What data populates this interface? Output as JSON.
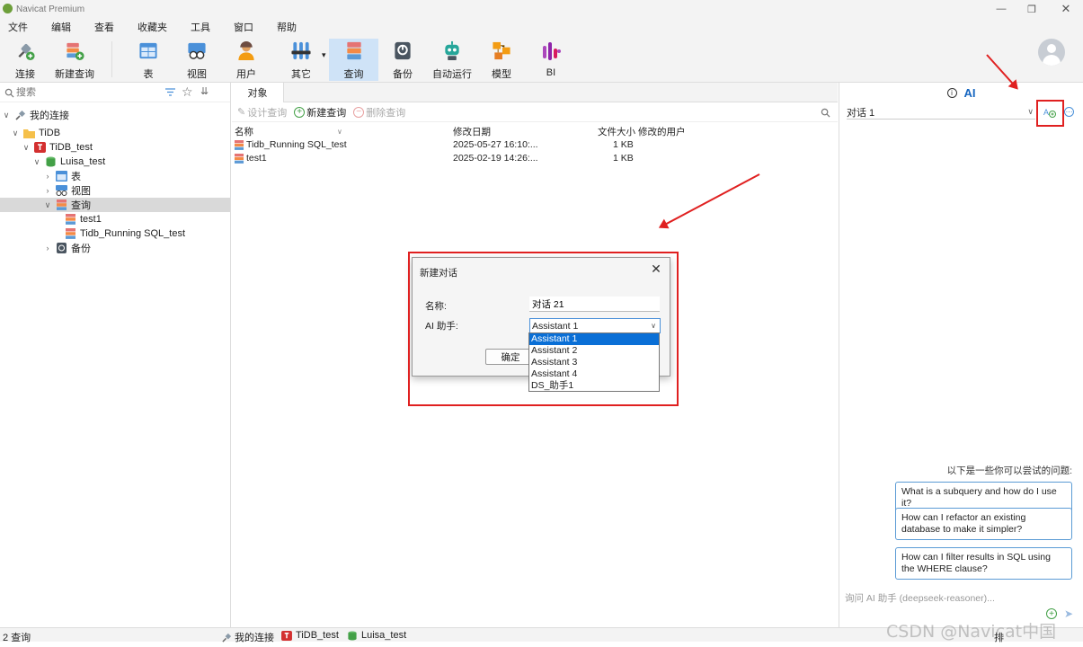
{
  "window": {
    "title": "Navicat Premium"
  },
  "menu": [
    "文件",
    "编辑",
    "查看",
    "收藏夹",
    "工具",
    "窗口",
    "帮助"
  ],
  "toolbar": {
    "tools": [
      {
        "label": "连接",
        "icon": "connection-icon"
      },
      {
        "label": "新建查询",
        "icon": "new-query-icon"
      },
      {
        "label": "表",
        "icon": "table-icon"
      },
      {
        "label": "视图",
        "icon": "view-icon"
      },
      {
        "label": "用户",
        "icon": "user-icon"
      },
      {
        "label": "其它",
        "icon": "other-icon"
      },
      {
        "label": "查询",
        "icon": "query-icon"
      },
      {
        "label": "备份",
        "icon": "backup-icon"
      },
      {
        "label": "自动运行",
        "icon": "automation-icon"
      },
      {
        "label": "模型",
        "icon": "model-icon"
      },
      {
        "label": "BI",
        "icon": "bi-icon"
      }
    ],
    "active_tool": "查询"
  },
  "sidebar": {
    "search_placeholder": "搜索",
    "tree": {
      "root": "我的连接",
      "group": "TiDB",
      "connection": "TiDB_test",
      "database": "Luisa_test",
      "table_node": "表",
      "view_node": "视图",
      "query_node": "查询",
      "query_items": [
        "test1",
        "Tidb_Running SQL_test"
      ],
      "backup_node": "备份"
    }
  },
  "center": {
    "tab": "对象",
    "toolbar": {
      "design": "设计查询",
      "new": "新建查询",
      "delete": "删除查询"
    },
    "columns": [
      "名称",
      "修改日期",
      "文件大小",
      "修改的用户"
    ],
    "rows": [
      {
        "name": "Tidb_Running SQL_test",
        "date": "2025-05-27 16:10:...",
        "size": "1 KB"
      },
      {
        "name": "test1",
        "date": "2025-02-19 14:26:...",
        "size": "1 KB"
      }
    ]
  },
  "dialog": {
    "title": "新建对话",
    "name_label": "名称:",
    "name_value": "对话 21",
    "assistant_label": "AI 助手:",
    "assistant_value": "Assistant 1",
    "ok": "确定",
    "options": [
      "Assistant 1",
      "Assistant 2",
      "Assistant 3",
      "Assistant 4",
      "DS_助手1"
    ]
  },
  "ai_panel": {
    "header": "AI",
    "conversation": "对话 1",
    "suggestions_title": "以下是一些你可以尝试的问题:",
    "suggestions": [
      "What is a subquery and how do I use it?",
      "How can I refactor an existing database to make it simpler?",
      "How can I filter results in SQL using the WHERE clause?"
    ],
    "input_placeholder": "询问 AI 助手 (deepseek-reasoner)..."
  },
  "statusbar": {
    "count": "2 查询",
    "crumbs": [
      "我的连接",
      "TiDB_test",
      "Luisa_test"
    ],
    "right": "排"
  },
  "watermark": "CSDN @Navicat中国",
  "colors": {
    "accent": "#1565c0",
    "selection": "#0a6fd6",
    "annotation": "#e02020"
  }
}
